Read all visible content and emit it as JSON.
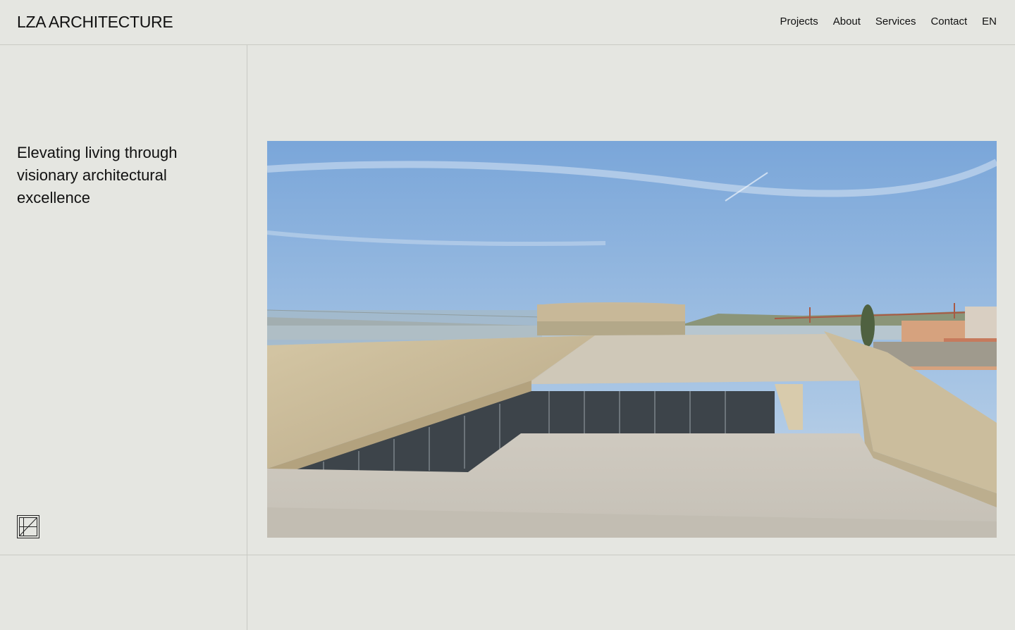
{
  "header": {
    "logo": "LZA ARCHITECTURE",
    "nav": [
      "Projects",
      "About",
      "Services",
      "Contact",
      "EN"
    ]
  },
  "hero": {
    "tagline": "Elevating living through visionary architectural excellence"
  },
  "colors": {
    "background": "#e5e6e1",
    "divider": "#c9cac4",
    "text": "#111111"
  },
  "icons": {
    "mark": "square-diagonal-logo-icon"
  }
}
